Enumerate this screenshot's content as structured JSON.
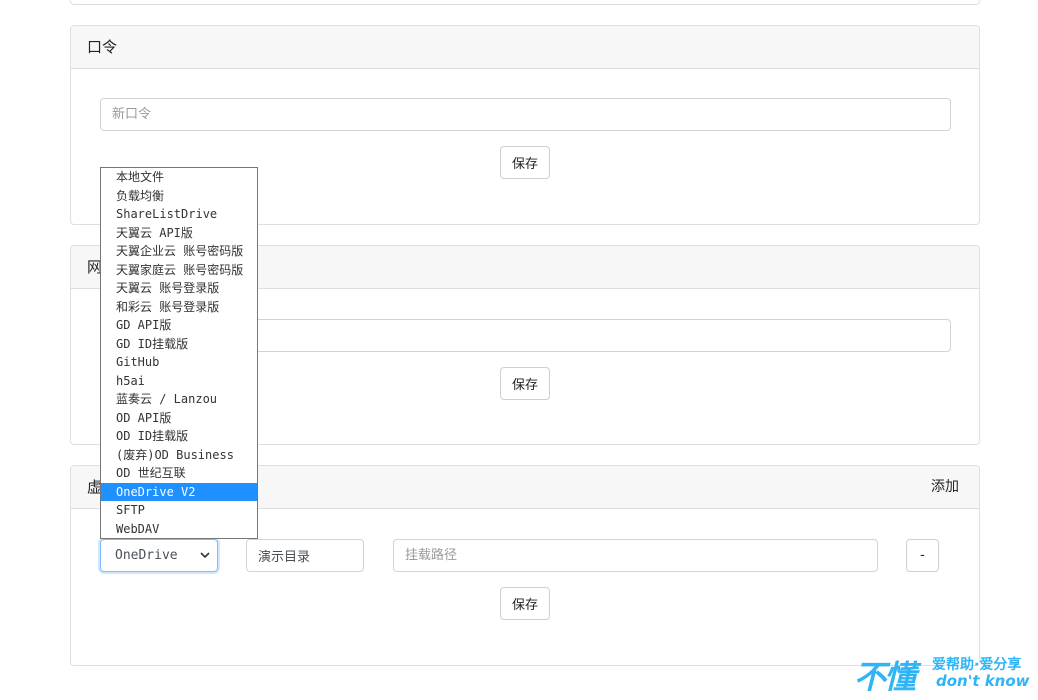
{
  "password_card": {
    "title": "口令",
    "new_password_placeholder": "新口令",
    "save_label": "保存"
  },
  "network_card": {
    "title": "网",
    "save_label": "保存"
  },
  "virtual_dir_card": {
    "title": "虚",
    "add_label": "添加",
    "drive_select_value": "OneDrive",
    "demo_dir_value": "演示目录",
    "mount_path_placeholder": "挂载路径",
    "remove_label": "-",
    "save_label": "保存"
  },
  "drive_options": [
    "本地文件",
    "负载均衡",
    "ShareListDrive",
    "天翼云 API版",
    "天翼企业云 账号密码版",
    "天翼家庭云 账号密码版",
    "天翼云 账号登录版",
    "和彩云 账号登录版",
    "GD API版",
    "GD ID挂载版",
    "GitHub",
    "h5ai",
    "蓝奏云 / Lanzou",
    "OD API版",
    "OD ID挂载版",
    "(废弃)OD Business",
    "OD 世纪互联",
    "OneDrive V2",
    "SFTP",
    "WebDAV"
  ],
  "selected_option_index": 17,
  "colors": {
    "highlight": "#1e90ff",
    "focus_border": "#80bdff",
    "header_bg": "#f7f7f7",
    "watermark": "#2fb4f5"
  },
  "watermark": {
    "big": "不懂",
    "line1": "爱帮助·爱分享",
    "line2": "don't know"
  }
}
